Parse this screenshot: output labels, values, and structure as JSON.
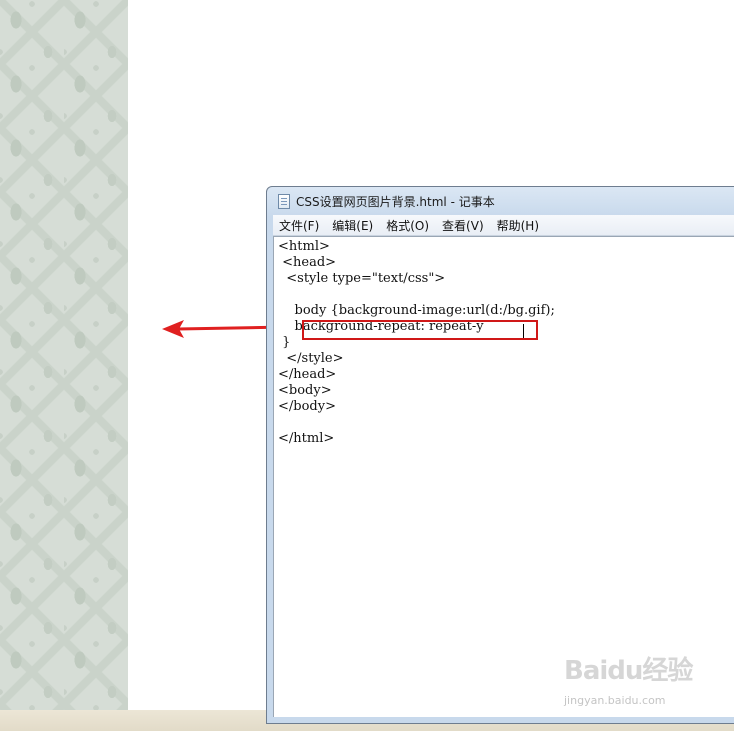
{
  "window": {
    "title": "CSS设置网页图片背景.html - 记事本",
    "icon": "notepad-icon"
  },
  "menu": [
    "文件(F)",
    "编辑(E)",
    "格式(O)",
    "查看(V)",
    "帮助(H)"
  ],
  "code_lines": [
    "<html>",
    " <head>",
    "  <style type=\"text/css\">",
    "",
    "    body {background-image:url(d:/bg.gif);",
    "    background-repeat: repeat-y",
    " }",
    "  </style>",
    "</head>",
    "<body>",
    "</body>",
    "",
    "</html>"
  ],
  "annotation": {
    "highlight_color": "#d01818",
    "arrow_color": "#e02020",
    "arrow_direction": "left"
  },
  "watermark": {
    "logo": "Baidu经验",
    "url": "jingyan.baidu.com"
  }
}
